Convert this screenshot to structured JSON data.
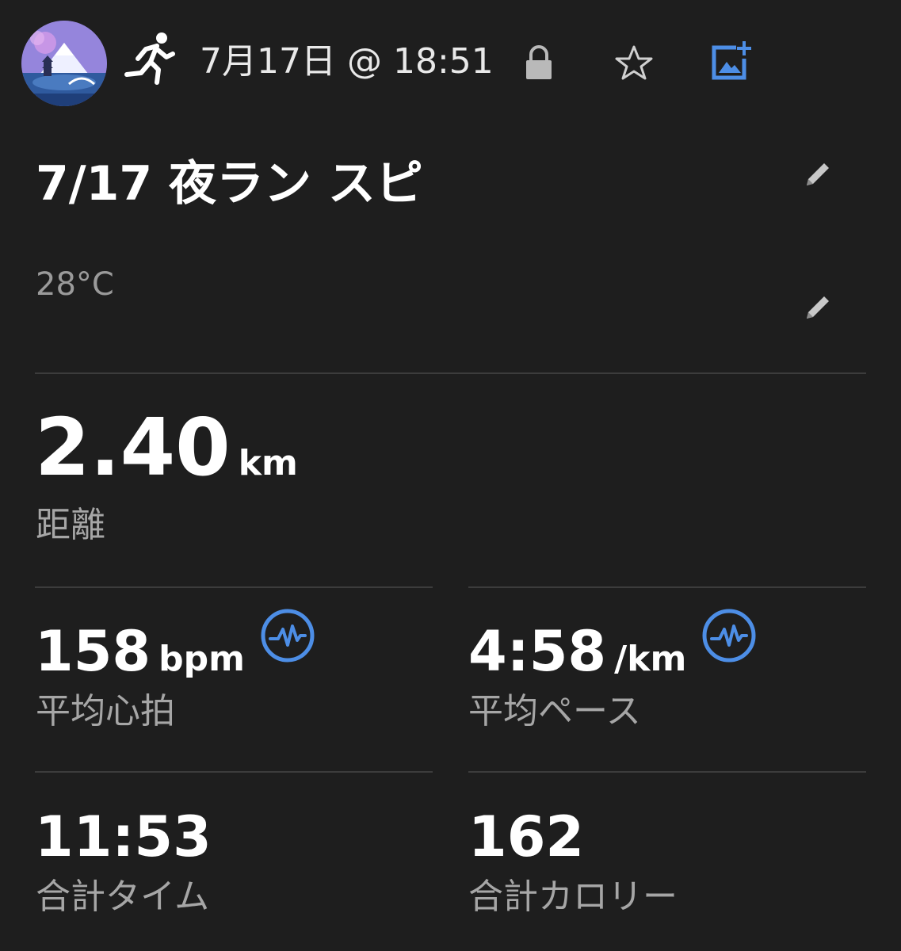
{
  "header": {
    "date_time": "7月17日 @ 18:51",
    "activity_type_icon": "running-icon",
    "lock_icon": "lock-icon",
    "favorite_icon": "star-icon",
    "add_photo_icon": "add-photo-icon"
  },
  "activity": {
    "title": "7/17 夜ラン スピ",
    "temperature": "28°C"
  },
  "stats": {
    "distance": {
      "value": "2.40",
      "unit": "km",
      "label": "距離"
    },
    "avg_heart_rate": {
      "value": "158",
      "unit": "bpm",
      "label": "平均心拍"
    },
    "avg_pace": {
      "value": "4:58",
      "unit": "/km",
      "label": "平均ペース"
    },
    "total_time": {
      "value": "11:53",
      "label": "合計タイム"
    },
    "total_calories": {
      "value": "162",
      "label": "合計カロリー"
    }
  },
  "colors": {
    "background": "#1e1e1e",
    "accent": "#4d8ee6",
    "label": "#a6a6a6",
    "divider": "#3c3c3c"
  }
}
